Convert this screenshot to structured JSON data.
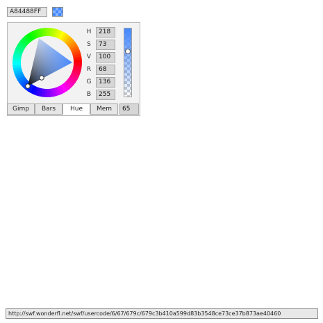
{
  "hex": {
    "value": "A84488FF"
  },
  "swatch": {
    "color": "#4488ff"
  },
  "channels": [
    {
      "label": "H",
      "value": "218"
    },
    {
      "label": "S",
      "value": "73"
    },
    {
      "label": "V",
      "value": "100"
    },
    {
      "label": "R",
      "value": "68"
    },
    {
      "label": "G",
      "value": "136"
    },
    {
      "label": "B",
      "value": "255"
    }
  ],
  "alpha": {
    "value": "65",
    "color": "#4488ff"
  },
  "tabs": [
    {
      "label": "Gimp",
      "active": false
    },
    {
      "label": "Bars",
      "active": false
    },
    {
      "label": "Hue",
      "active": true
    },
    {
      "label": "Mem",
      "active": false
    }
  ],
  "status": {
    "url": "http://swf.wonderfl.net/swf/usercode/6/67/679c/679c3b410a599d83b3548ce73ce37b873ae40460"
  }
}
